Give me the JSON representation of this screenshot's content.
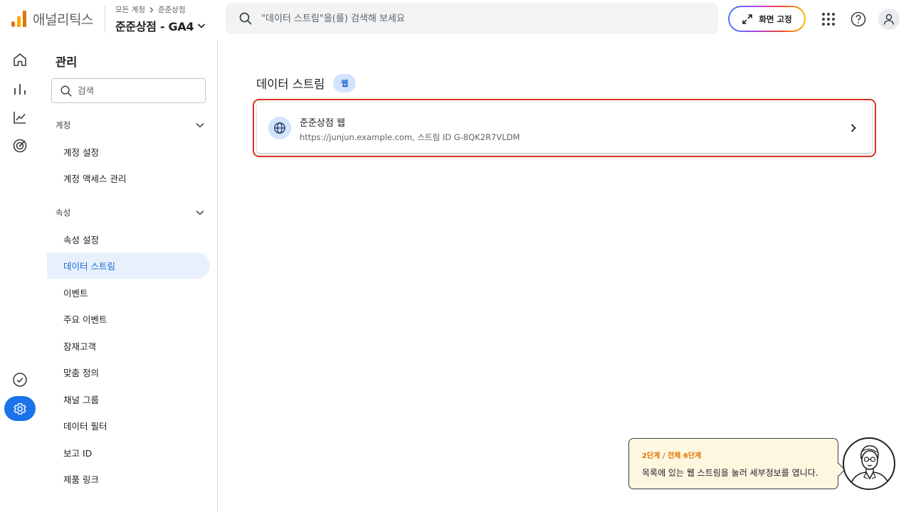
{
  "header": {
    "app_name": "애널리틱스",
    "breadcrumb": [
      "모든 계정",
      "준준상점"
    ],
    "property_title": "준준상점 - GA4",
    "search_placeholder": "\"데이터 스트림\"을(를) 검색해 보세요",
    "fullscreen_label": "화면 고정"
  },
  "admin": {
    "title": "관리",
    "search_placeholder": "검색",
    "sections": [
      {
        "label": "계정",
        "items": [
          "계정 설정",
          "계정 액세스 관리"
        ]
      },
      {
        "label": "속성",
        "items": [
          "속성 설정",
          "데이터 스트림",
          "이벤트",
          "주요 이벤트",
          "잠재고객",
          "맞춤 정의",
          "채널 그룹",
          "데이터 필터",
          "보고 ID",
          "제품 링크"
        ]
      }
    ],
    "active_item": "데이터 스트림"
  },
  "main": {
    "title": "데이터 스트림",
    "filter_chip": "웹",
    "streams": [
      {
        "name": "준준상점 웹",
        "detail": "https://junjun.example.com, 스트림 ID G-8QK2R7VLDM"
      }
    ]
  },
  "tutorial": {
    "step": "2단계 / 전체 6단계",
    "message": "목록에 있는 웹 스트림을 눌러 세부정보를 엽니다."
  },
  "icons": {
    "rail": [
      "home-icon",
      "reports-icon",
      "explore-icon",
      "advertising-icon",
      "check-circle-icon",
      "settings-icon"
    ],
    "top": [
      "search-icon",
      "expand-icon",
      "apps-icon",
      "help-icon",
      "account-icon"
    ]
  },
  "colors": {
    "accent": "#1a73e8",
    "active_bg": "#e8f0fe",
    "highlight": "#d93025",
    "tooltip_bg": "#fef7e0"
  }
}
